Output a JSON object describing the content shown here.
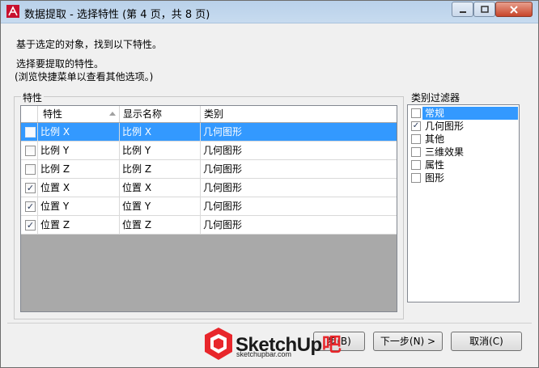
{
  "window": {
    "title": "数据提取 - 选择特性 (第 4 页，共 8 页)"
  },
  "intro": {
    "line1": "基于选定的对象，找到以下特性。",
    "line2": "选择要提取的特性。",
    "line3": "(浏览快捷菜单以查看其他选项。)"
  },
  "properties": {
    "group_label": "特性",
    "columns": [
      "特性",
      "显示名称",
      "类别"
    ],
    "rows": [
      {
        "checked": false,
        "property": "比例 X",
        "display_name": "比例 X",
        "category": "几何图形",
        "selected": true
      },
      {
        "checked": false,
        "property": "比例 Y",
        "display_name": "比例 Y",
        "category": "几何图形",
        "selected": false
      },
      {
        "checked": false,
        "property": "比例 Z",
        "display_name": "比例 Z",
        "category": "几何图形",
        "selected": false
      },
      {
        "checked": true,
        "property": "位置 X",
        "display_name": "位置 X",
        "category": "几何图形",
        "selected": false
      },
      {
        "checked": true,
        "property": "位置 Y",
        "display_name": "位置 Y",
        "category": "几何图形",
        "selected": false
      },
      {
        "checked": true,
        "property": "位置 Z",
        "display_name": "位置 Z",
        "category": "几何图形",
        "selected": false
      }
    ]
  },
  "category_filter": {
    "group_label": "类别过滤器",
    "items": [
      {
        "label": "常规",
        "checked": false,
        "selected": true
      },
      {
        "label": "几何图形",
        "checked": true,
        "selected": false
      },
      {
        "label": "其他",
        "checked": false,
        "selected": false
      },
      {
        "label": "三维效果",
        "checked": false,
        "selected": false
      },
      {
        "label": "属性",
        "checked": false,
        "selected": false
      },
      {
        "label": "图形",
        "checked": false,
        "selected": false
      }
    ]
  },
  "buttons": {
    "back_label": "步(B)",
    "next_label": "下一步(N) >",
    "cancel_label": "取消(C)"
  },
  "watermark": {
    "brand": "SketchUp",
    "url": "sketchupbar.com",
    "color": "#e8262b"
  },
  "colors": {
    "selection": "#3399ff",
    "grid_background": "#a9a9a9"
  }
}
